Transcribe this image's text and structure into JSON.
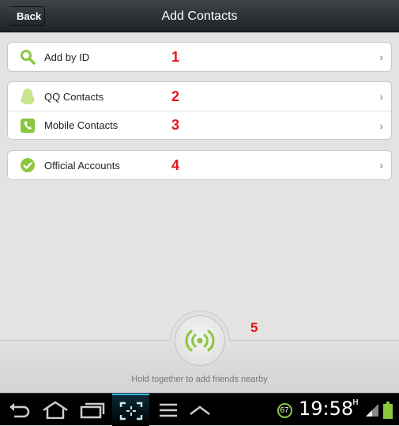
{
  "header": {
    "back_label": "Back",
    "title": "Add Contacts"
  },
  "groups": [
    {
      "items": [
        {
          "label": "Add by ID",
          "icon": "search-icon",
          "marker": "1"
        }
      ]
    },
    {
      "items": [
        {
          "label": "QQ Contacts",
          "icon": "qq-penguin-icon",
          "marker": "2"
        },
        {
          "label": "Mobile Contacts",
          "icon": "phone-icon",
          "marker": "3"
        }
      ]
    },
    {
      "items": [
        {
          "label": "Official Accounts",
          "icon": "check-badge-icon",
          "marker": "4"
        }
      ]
    }
  ],
  "nearby": {
    "hint": "Hold together to add friends nearby",
    "marker": "5",
    "icon": "radar-signal-icon"
  },
  "status_bar": {
    "time": "19:58",
    "badge": "67",
    "network": "H"
  },
  "colors": {
    "accent_green": "#8cc63f",
    "marker_red": "#e5141c"
  }
}
